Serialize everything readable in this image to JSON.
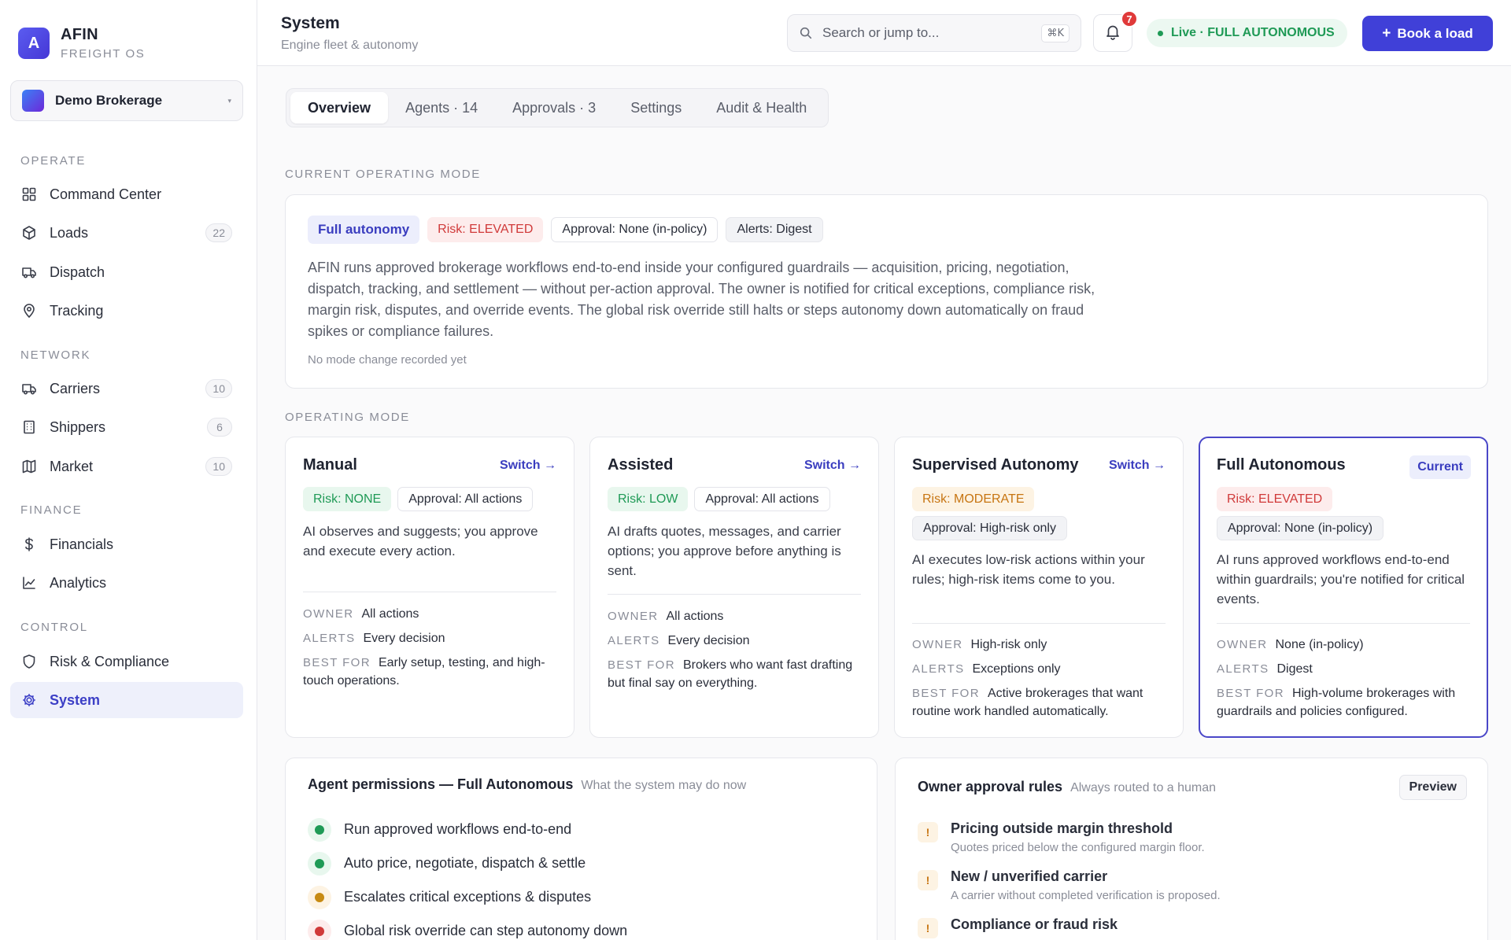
{
  "brand": {
    "logo_letter": "A",
    "name": "AFIN",
    "sub": "FREIGHT OS"
  },
  "workspace": {
    "name": "Demo Brokerage",
    "caret": "▾"
  },
  "nav": {
    "operate_label": "OPERATE",
    "network_label": "NETWORK",
    "finance_label": "FINANCE",
    "control_label": "CONTROL",
    "items": [
      {
        "label": "Command Center",
        "icon": "grid-icon"
      },
      {
        "label": "Loads",
        "count": "22",
        "icon": "box-icon"
      },
      {
        "label": "Dispatch",
        "icon": "truck-icon"
      },
      {
        "label": "Tracking",
        "icon": "map-pin-icon"
      },
      {
        "label": "Carriers",
        "count": "10",
        "icon": "truck-icon"
      },
      {
        "label": "Shippers",
        "count": "6",
        "icon": "building-icon"
      },
      {
        "label": "Market",
        "count": "10",
        "icon": "map-icon"
      },
      {
        "label": "Financials",
        "icon": "dollar-icon"
      },
      {
        "label": "Analytics",
        "icon": "line-chart-icon"
      },
      {
        "label": "Risk & Compliance",
        "icon": "shield-icon"
      },
      {
        "label": "System",
        "icon": "gear-icon",
        "active": true
      }
    ]
  },
  "header": {
    "title": "System",
    "subtitle": "Engine fleet & autonomy",
    "search_placeholder": "Search or jump to...",
    "search_shortcut": "⌘K",
    "notifications_count": "7",
    "live_status": "Live · FULL AUTONOMOUS",
    "book_button_plus": "+",
    "book_button": "Book a load"
  },
  "tabs": [
    {
      "label": "Overview",
      "active": true
    },
    {
      "label": "Agents · 14"
    },
    {
      "label": "Approvals · 3"
    },
    {
      "label": "Settings"
    },
    {
      "label": "Audit & Health"
    }
  ],
  "current_mode": {
    "section_label": "CURRENT OPERATING MODE",
    "mode_chip": "Full autonomy",
    "risk_chip": "Risk: ELEVATED",
    "approval_chip": "Approval: None (in-policy)",
    "alerts_chip": "Alerts: Digest",
    "description": "AFIN runs approved brokerage workflows end-to-end inside your configured guardrails — acquisition, pricing, negotiation, dispatch, tracking, and settlement — without per-action approval. The owner is notified for critical exceptions, compliance risk, margin risk, disputes, and override events. The global risk override still halts or steps autonomy down automatically on fraud spikes or compliance failures.",
    "note": "No mode change recorded yet"
  },
  "operating_mode": {
    "section_label": "OPERATING MODE",
    "owner_key": "OWNER",
    "alerts_key": "ALERTS",
    "best_for_key": "BEST FOR",
    "switch_label": "Switch →",
    "current_label": "Current",
    "modes": [
      {
        "title": "Manual",
        "risk": "Risk: NONE",
        "approval": "Approval: All actions",
        "description": "AI observes and suggests; you approve and execute every action.",
        "owner": "All actions",
        "alerts": "Every decision",
        "best_for": "Early setup, testing, and high-touch operations."
      },
      {
        "title": "Assisted",
        "risk": "Risk: LOW",
        "approval": "Approval: All actions",
        "description": "AI drafts quotes, messages, and carrier options; you approve before anything is sent.",
        "owner": "All actions",
        "alerts": "Every decision",
        "best_for": "Brokers who want fast drafting but final say on everything."
      },
      {
        "title": "Supervised Autonomy",
        "risk": "Risk: MODERATE",
        "approval": "Approval: High-risk only",
        "description": "AI executes low-risk actions within your rules; high-risk items come to you.",
        "owner": "High-risk only",
        "alerts": "Exceptions only",
        "best_for": "Active brokerages that want routine work handled automatically."
      },
      {
        "title": "Full Autonomous",
        "risk": "Risk: ELEVATED",
        "approval": "Approval: None (in-policy)",
        "description": "AI runs approved workflows end-to-end within guardrails; you're notified for critical events.",
        "owner": "None (in-policy)",
        "alerts": "Digest",
        "best_for": "High-volume brokerages with guardrails and policies configured."
      }
    ]
  },
  "permissions": {
    "title": "Agent permissions — Full Autonomous",
    "subtitle": "What the system may do now",
    "items": [
      {
        "label": "Run approved workflows end-to-end",
        "color": "#1f9a56"
      },
      {
        "label": "Auto price, negotiate, dispatch & settle",
        "color": "#1f9a56"
      },
      {
        "label": "Escalates critical exceptions & disputes",
        "color": "#c78a12"
      },
      {
        "label": "Global risk override can step autonomy down",
        "color": "#d03a3a"
      }
    ]
  },
  "approval_rules": {
    "title": "Owner approval rules",
    "subtitle": "Always routed to a human",
    "preview_button": "Preview",
    "rule_icon": "!",
    "rules": [
      {
        "title": "Pricing outside margin threshold",
        "desc": "Quotes priced below the configured margin floor."
      },
      {
        "title": "New / unverified carrier",
        "desc": "A carrier without completed verification is proposed."
      },
      {
        "title": "Compliance or fraud risk",
        "desc": ""
      }
    ]
  }
}
